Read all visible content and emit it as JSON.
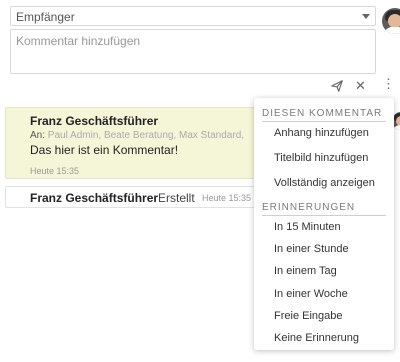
{
  "recipient": {
    "placeholder": "Empfänger"
  },
  "comment_input": {
    "placeholder": "Kommentar hinzufügen"
  },
  "toolbar": {
    "send_icon": "send-icon",
    "close_icon": "close-icon",
    "more_icon": "more-vertical-icon"
  },
  "comments": [
    {
      "author": "Franz Geschäftsführer",
      "to_label": "An:",
      "to_recipients": "Paul Admin, Beate Beratung, Max Standard,",
      "text": "Das hier ist ein Kommentar!",
      "time": "Heute 15:35"
    },
    {
      "author": "Franz Geschäftsführer",
      "status": "Erstellt",
      "time": "Heute 15:35"
    }
  ],
  "menu": {
    "section1": "DIESEN KOMMENTAR",
    "section1_items": [
      "Anhang hinzufügen",
      "Titelbild hinzufügen",
      "Vollständig anzeigen"
    ],
    "section2": "ERINNERUNGEN",
    "section2_items": [
      "In 15 Minuten",
      "In einer Stunde",
      "In einem Tag",
      "In einer Woche",
      "Freie Eingabe",
      "Keine Erinnerung"
    ]
  },
  "colors": {
    "card_bg": "#f5f6d8",
    "menu_section": "#7b7b7b"
  }
}
